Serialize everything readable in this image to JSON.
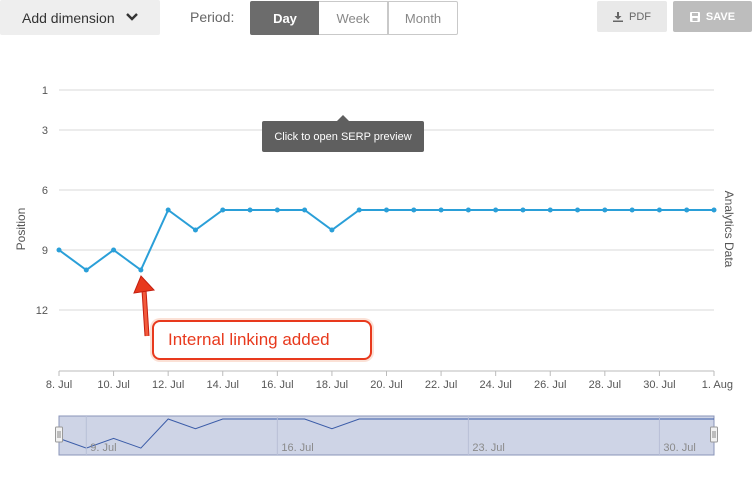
{
  "toolbar": {
    "add_dimension_label": "Add dimension",
    "period_label": "Period:",
    "periods": [
      "Day",
      "Week",
      "Month"
    ],
    "selected_period": "Day",
    "pdf_label": "PDF",
    "save_label": "SAVE"
  },
  "tooltip": {
    "text": "Click to open SERP preview"
  },
  "annotation": {
    "text": "Internal linking added",
    "color": "#e8391d"
  },
  "colors": {
    "line": "#2a9fd8",
    "navigator_fill": "#ced4e6",
    "navigator_line": "#3b5ca8"
  },
  "chart_data": {
    "type": "line",
    "ylabel": "Position",
    "right_label": "Analytics Data",
    "y_reversed": true,
    "y_ticks": [
      1,
      3,
      6,
      9,
      12
    ],
    "ylim": [
      1,
      15
    ],
    "x_ticks": [
      "8. Jul",
      "10. Jul",
      "12. Jul",
      "14. Jul",
      "16. Jul",
      "18. Jul",
      "20. Jul",
      "22. Jul",
      "24. Jul",
      "26. Jul",
      "28. Jul",
      "30. Jul",
      "1. Aug"
    ],
    "x": [
      "8. Jul",
      "9. Jul",
      "10. Jul",
      "11. Jul",
      "12. Jul",
      "13. Jul",
      "14. Jul",
      "15. Jul",
      "16. Jul",
      "17. Jul",
      "18. Jul",
      "19. Jul",
      "20. Jul",
      "21. Jul",
      "22. Jul",
      "23. Jul",
      "24. Jul",
      "25. Jul",
      "26. Jul",
      "27. Jul",
      "28. Jul",
      "29. Jul",
      "30. Jul",
      "31. Jul",
      "1. Aug"
    ],
    "series": [
      {
        "values": [
          9,
          10,
          9,
          10,
          7,
          8,
          7,
          7,
          7,
          7,
          8,
          7,
          7,
          7,
          7,
          7,
          7,
          7,
          7,
          7,
          7,
          7,
          7,
          7,
          7
        ]
      }
    ],
    "navigator_labels": [
      "9. Jul",
      "16. Jul",
      "23. Jul",
      "30. Jul"
    ],
    "grid": true
  }
}
